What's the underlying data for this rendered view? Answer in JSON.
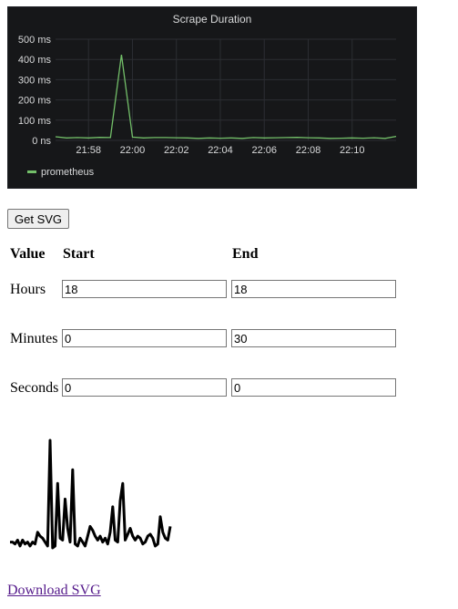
{
  "panel": {
    "title": "Scrape Duration",
    "legend": "prometheus",
    "series_color": "#73bf69",
    "bg_color": "#161719"
  },
  "chart_data": {
    "type": "line",
    "title": "Scrape Duration",
    "y_ticks": [
      "0 ns",
      "100 ms",
      "200 ms",
      "300 ms",
      "400 ms",
      "500 ms"
    ],
    "ylim": [
      0,
      500
    ],
    "x_ticks": [
      "21:58",
      "22:00",
      "22:02",
      "22:04",
      "22:06",
      "22:08",
      "22:10"
    ],
    "x_tick_minutes": [
      -2,
      0,
      2,
      4,
      6,
      8,
      10
    ],
    "xlim_minutes": [
      -3.5,
      12
    ],
    "grid": true,
    "legend_position": "bottom-left",
    "series": [
      {
        "name": "prometheus",
        "x_minutes": [
          -3.5,
          -3.0,
          -2.5,
          -2.0,
          -1.5,
          -1.0,
          -0.5,
          0.0,
          0.5,
          1.0,
          1.5,
          2.0,
          2.5,
          3.0,
          3.5,
          4.0,
          4.5,
          5.0,
          5.5,
          6.0,
          6.5,
          7.0,
          7.5,
          8.0,
          8.5,
          9.0,
          9.5,
          10.0,
          10.5,
          11.0,
          11.5,
          12.0
        ],
        "values": [
          18,
          12,
          14,
          12,
          15,
          14,
          423,
          16,
          12,
          14,
          14,
          13,
          12,
          10,
          12,
          11,
          12,
          10,
          14,
          12,
          13,
          14,
          15,
          13,
          12,
          10,
          11,
          12,
          11,
          13,
          10,
          20
        ]
      }
    ]
  },
  "get_svg_label": "Get SVG",
  "table": {
    "headers": [
      "Value",
      "Start",
      "End"
    ],
    "rows": [
      {
        "label": "Hours",
        "start": "18",
        "end": "18"
      },
      {
        "label": "Minutes",
        "start": "0",
        "end": "30"
      },
      {
        "label": "Seconds",
        "start": "0",
        "end": "0"
      }
    ]
  },
  "sparkline": {
    "color": "#000000",
    "values": [
      3,
      3,
      2,
      4,
      1,
      4,
      2,
      3,
      1,
      3,
      2,
      8,
      6,
      5,
      3,
      1,
      55,
      0,
      1,
      33,
      5,
      4,
      25,
      10,
      3,
      40,
      2,
      1,
      5,
      3,
      1,
      6,
      11,
      9,
      6,
      4,
      6,
      3,
      5,
      2,
      8,
      21,
      4,
      3,
      24,
      33,
      4,
      7,
      10,
      6,
      4,
      6,
      5,
      2,
      3,
      6,
      7,
      5,
      1,
      2,
      16,
      8,
      5,
      4,
      11
    ]
  },
  "download_label": "Download SVG"
}
